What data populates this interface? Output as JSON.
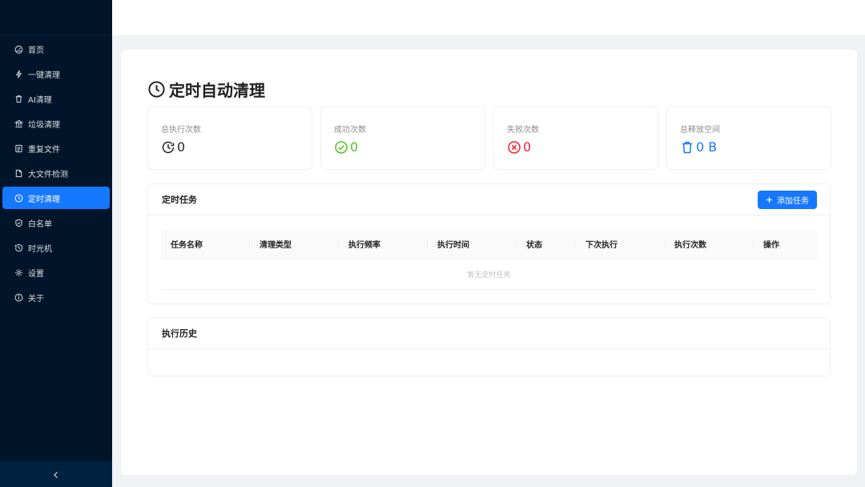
{
  "sidebar": {
    "items": [
      {
        "label": "首页",
        "icon": "dashboard-icon"
      },
      {
        "label": "一键清理",
        "icon": "lightning-icon"
      },
      {
        "label": "AI清理",
        "icon": "trash-icon"
      },
      {
        "label": "垃圾清理",
        "icon": "bank-icon"
      },
      {
        "label": "重复文件",
        "icon": "copy-file-icon"
      },
      {
        "label": "大文件检测",
        "icon": "file-icon"
      },
      {
        "label": "定时清理",
        "icon": "clock-icon",
        "active": true
      },
      {
        "label": "白名单",
        "icon": "safety-icon"
      },
      {
        "label": "时光机",
        "icon": "history-icon"
      },
      {
        "label": "设置",
        "icon": "gear-icon"
      },
      {
        "label": "关于",
        "icon": "info-icon"
      }
    ],
    "collapse_icon": "chevron-left-icon"
  },
  "page": {
    "title": "定时自动清理",
    "title_icon": "clock-icon"
  },
  "stats": [
    {
      "label": "总执行次数",
      "value": "0",
      "icon": "history-clock-icon",
      "color": "#262626"
    },
    {
      "label": "成功次数",
      "value": "0",
      "icon": "check-circle-icon",
      "color": "#52c41a"
    },
    {
      "label": "失败次数",
      "value": "0",
      "icon": "close-circle-icon",
      "color": "#f5222d"
    },
    {
      "label": "总释放空间",
      "value": "0 B",
      "icon": "trash-icon",
      "color": "#1677ff"
    }
  ],
  "tasks": {
    "title": "定时任务",
    "add_button": "添加任务",
    "columns": [
      "任务名称",
      "清理类型",
      "执行频率",
      "执行时间",
      "状态",
      "下次执行",
      "执行次数",
      "操作"
    ],
    "empty_text": "暂无定时任务"
  },
  "history": {
    "title": "执行历史"
  },
  "colors": {
    "sidebar_bg": "#001529",
    "accent": "#1677ff",
    "success": "#52c41a",
    "error": "#f5222d"
  }
}
